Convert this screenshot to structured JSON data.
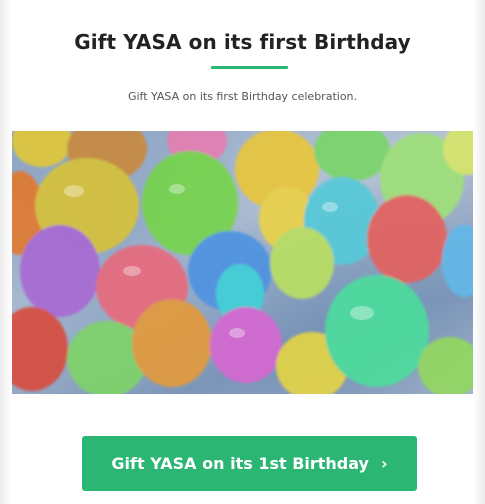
{
  "header": {
    "title": "Gift YASA on its first Birthday",
    "subtitle": "Gift YASA on its first Birthday celebration."
  },
  "banner": {
    "image_description": "watercolor-balloons-illustration"
  },
  "cta": {
    "label": "Gift YASA on its 1st Birthday",
    "chevron": "›",
    "icon": "chevron-right-icon"
  },
  "colors": {
    "accent": "#2bb673",
    "title_text": "#222222",
    "subtitle_text": "#555555",
    "button_text": "#ffffff"
  }
}
